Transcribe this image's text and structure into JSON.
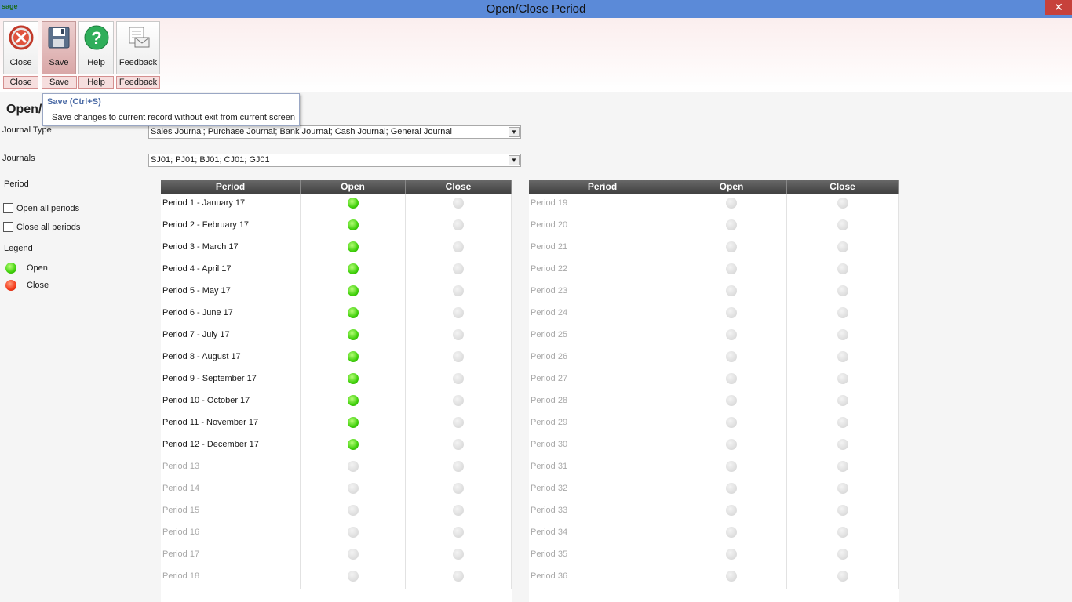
{
  "window": {
    "app_logo": "sage",
    "title": "Open/Close Period",
    "close_glyph": "✕"
  },
  "toolbar": {
    "buttons": [
      {
        "label": "Close",
        "sub_label": "Close",
        "icon": "close-icon"
      },
      {
        "label": "Save",
        "sub_label": "Save",
        "icon": "save-icon"
      },
      {
        "label": "Help",
        "sub_label": "Help",
        "icon": "help-icon"
      },
      {
        "label": "Feedback",
        "sub_label": "Feedback",
        "icon": "feedback-icon"
      }
    ]
  },
  "tooltip": {
    "title": "Save (Ctrl+S)",
    "description": "Save changes to current record without exit from current screen"
  },
  "page": {
    "heading": "Open/"
  },
  "form": {
    "journal_type_label": "Journal Type",
    "journal_type_value": "Sales Journal; Purchase Journal; Bank Journal; Cash Journal; General Journal",
    "journals_label": "Journals",
    "journals_value": "SJ01; PJ01; BJ01; CJ01; GJ01"
  },
  "sidebar": {
    "period_label": "Period",
    "open_all_label": "Open all periods",
    "close_all_label": "Close all periods",
    "legend_label": "Legend",
    "legend_open": "Open",
    "legend_close": "Close"
  },
  "colors": {
    "open": "#3fd00a",
    "close": "#f33a1a",
    "inactive": "#d8d8d8",
    "titlebar": "#5b8ad8"
  },
  "grid": {
    "headers": [
      "Period",
      "Open",
      "Close"
    ],
    "left": [
      {
        "name": "Period 1 - January 17",
        "status": "open",
        "active": true
      },
      {
        "name": "Period 2 - February 17",
        "status": "open",
        "active": true
      },
      {
        "name": "Period 3 - March 17",
        "status": "open",
        "active": true
      },
      {
        "name": "Period 4 - April 17",
        "status": "open",
        "active": true
      },
      {
        "name": "Period 5 - May 17",
        "status": "open",
        "active": true
      },
      {
        "name": "Period 6 - June 17",
        "status": "open",
        "active": true
      },
      {
        "name": "Period 7 - July 17",
        "status": "open",
        "active": true
      },
      {
        "name": "Period 8 - August 17",
        "status": "open",
        "active": true
      },
      {
        "name": "Period 9 - September 17",
        "status": "open",
        "active": true
      },
      {
        "name": "Period 10 - October 17",
        "status": "open",
        "active": true
      },
      {
        "name": "Period 11 - November 17",
        "status": "open",
        "active": true
      },
      {
        "name": "Period 12 - December 17",
        "status": "open",
        "active": true
      },
      {
        "name": "Period 13",
        "status": "none",
        "active": false
      },
      {
        "name": "Period 14",
        "status": "none",
        "active": false
      },
      {
        "name": "Period 15",
        "status": "none",
        "active": false
      },
      {
        "name": "Period 16",
        "status": "none",
        "active": false
      },
      {
        "name": "Period 17",
        "status": "none",
        "active": false
      },
      {
        "name": "Period 18",
        "status": "none",
        "active": false
      }
    ],
    "right": [
      {
        "name": "Period 19",
        "status": "none",
        "active": false
      },
      {
        "name": "Period 20",
        "status": "none",
        "active": false
      },
      {
        "name": "Period 21",
        "status": "none",
        "active": false
      },
      {
        "name": "Period 22",
        "status": "none",
        "active": false
      },
      {
        "name": "Period 23",
        "status": "none",
        "active": false
      },
      {
        "name": "Period 24",
        "status": "none",
        "active": false
      },
      {
        "name": "Period 25",
        "status": "none",
        "active": false
      },
      {
        "name": "Period 26",
        "status": "none",
        "active": false
      },
      {
        "name": "Period 27",
        "status": "none",
        "active": false
      },
      {
        "name": "Period 28",
        "status": "none",
        "active": false
      },
      {
        "name": "Period 29",
        "status": "none",
        "active": false
      },
      {
        "name": "Period 30",
        "status": "none",
        "active": false
      },
      {
        "name": "Period 31",
        "status": "none",
        "active": false
      },
      {
        "name": "Period 32",
        "status": "none",
        "active": false
      },
      {
        "name": "Period 33",
        "status": "none",
        "active": false
      },
      {
        "name": "Period 34",
        "status": "none",
        "active": false
      },
      {
        "name": "Period 35",
        "status": "none",
        "active": false
      },
      {
        "name": "Period 36",
        "status": "none",
        "active": false
      }
    ]
  }
}
